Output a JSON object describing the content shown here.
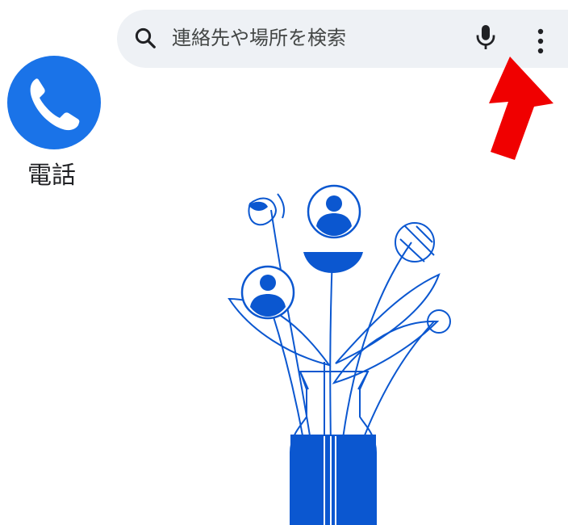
{
  "search": {
    "placeholder": "連絡先や場所を検索",
    "icon": "search-icon",
    "voice_icon": "microphone-icon",
    "menu_icon": "more-vert-icon"
  },
  "app": {
    "label": "電話",
    "icon": "phone-icon",
    "icon_color": "#1a73e8"
  },
  "annotation": {
    "arrow_color": "#f00000"
  },
  "illustration": {
    "name": "flowers-in-vase-illustration",
    "color": "#0b57d0"
  }
}
